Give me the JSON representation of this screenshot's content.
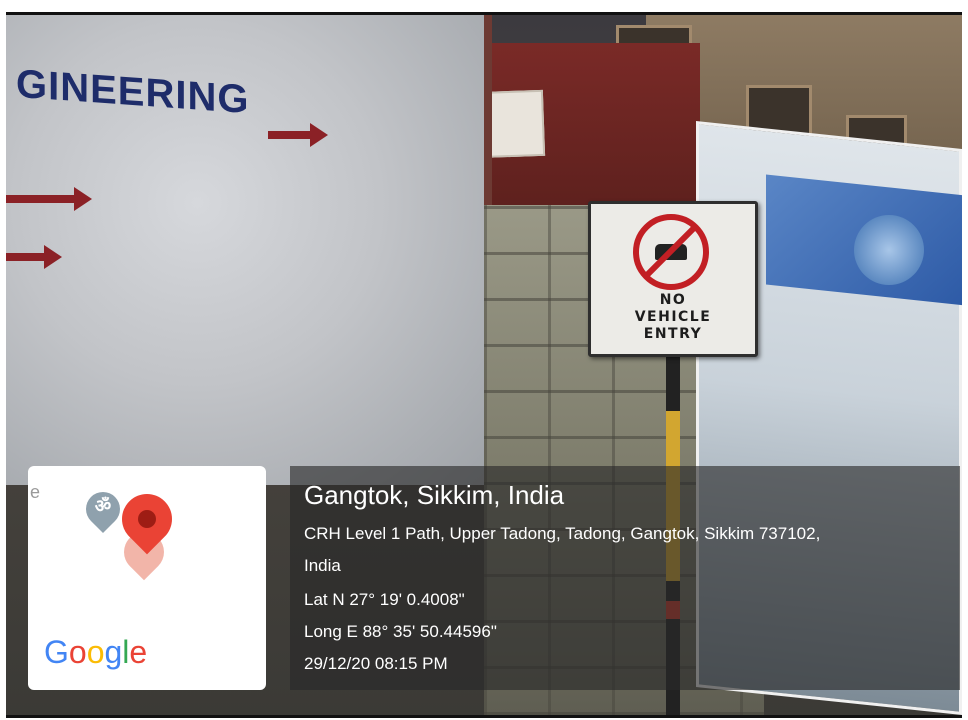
{
  "scene": {
    "hoarding_text": "GINEERING",
    "sign": {
      "icon": "no-car-entry-icon",
      "line1": "NO",
      "line2": "VEHICLE",
      "line3": "ENTRY"
    }
  },
  "map_card": {
    "faint_text": "e",
    "temple_glyph": "ॐ",
    "pin_icon": "red-location-pin-icon",
    "logo": [
      "G",
      "o",
      "o",
      "g",
      "l",
      "e"
    ]
  },
  "location": {
    "title": "Gangtok, Sikkim, India",
    "address_line1": "CRH Level 1 Path, Upper Tadong, Tadong, Gangtok, Sikkim 737102,",
    "address_line2": "India",
    "lat": "Lat N 27° 19' 0.4008\"",
    "long": "Long E 88° 35' 50.44596\"",
    "timestamp": "29/12/20 08:15 PM"
  },
  "colors": {
    "sign_red": "#c21f24",
    "hoarding_text": "#1e2c6a",
    "google_blue": "#4285f4",
    "google_red": "#ea4335"
  }
}
